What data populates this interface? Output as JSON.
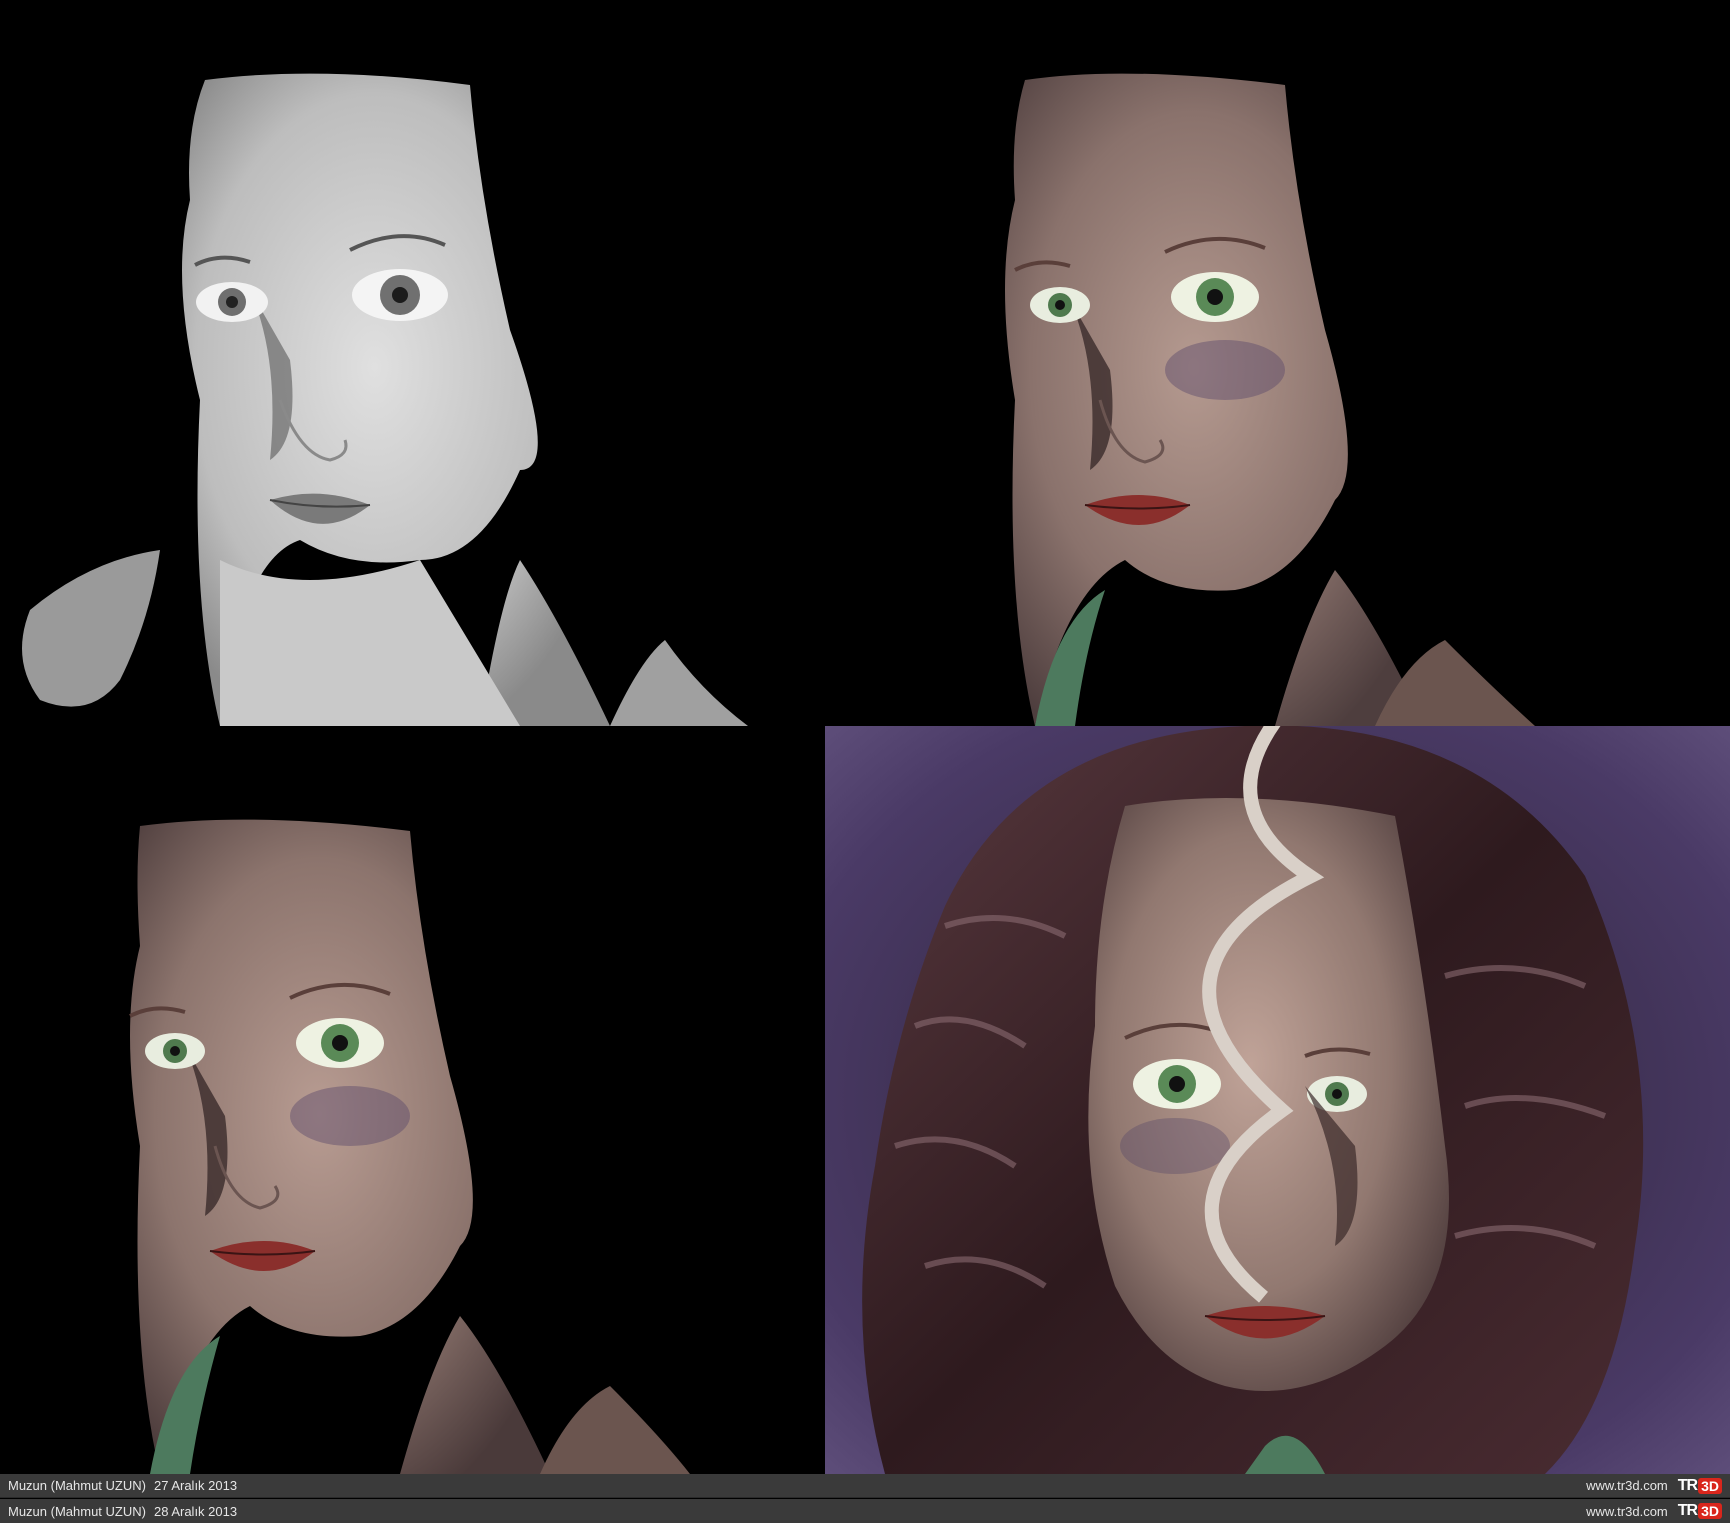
{
  "captions": [
    {
      "author": "Muzun (Mahmut UZUN)",
      "date": "27 Aralık 2013",
      "url": "www.tr3d.com",
      "logo_text": "TR",
      "logo_badge": "3D"
    },
    {
      "author": "Muzun (Mahmut UZUN)",
      "date": "28 Aralık 2013",
      "url": "www.tr3d.com",
      "logo_text": "TR",
      "logo_badge": "3D"
    }
  ],
  "colors": {
    "background": "#000000",
    "caption_bar": "#3a3a3a",
    "logo_red": "#d9261c",
    "purple_backdrop": "#4a3a66",
    "skin": "#9a8078",
    "hair": "#3a2226"
  }
}
